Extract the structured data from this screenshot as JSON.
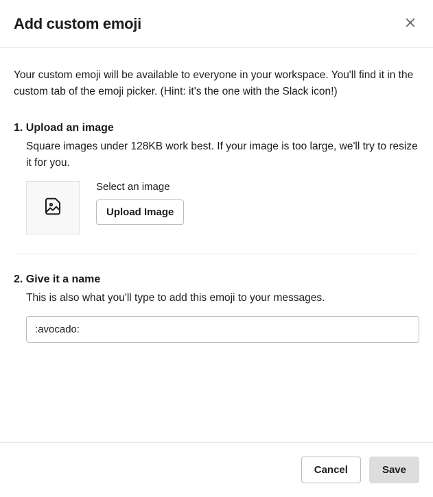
{
  "header": {
    "title": "Add custom emoji"
  },
  "intro": "Your custom emoji will be available to everyone in your workspace. You'll find it in the custom tab of the emoji picker. (Hint: it's the one with the Slack icon!)",
  "step1": {
    "heading": "1. Upload an image",
    "description": "Square images under 128KB work best. If your image is too large, we'll try to resize it for you.",
    "select_label": "Select an image",
    "upload_button": "Upload Image"
  },
  "step2": {
    "heading": "2. Give it a name",
    "description": "This is also what you'll type to add this emoji to your messages.",
    "input_value": ":avocado:"
  },
  "footer": {
    "cancel": "Cancel",
    "save": "Save"
  }
}
